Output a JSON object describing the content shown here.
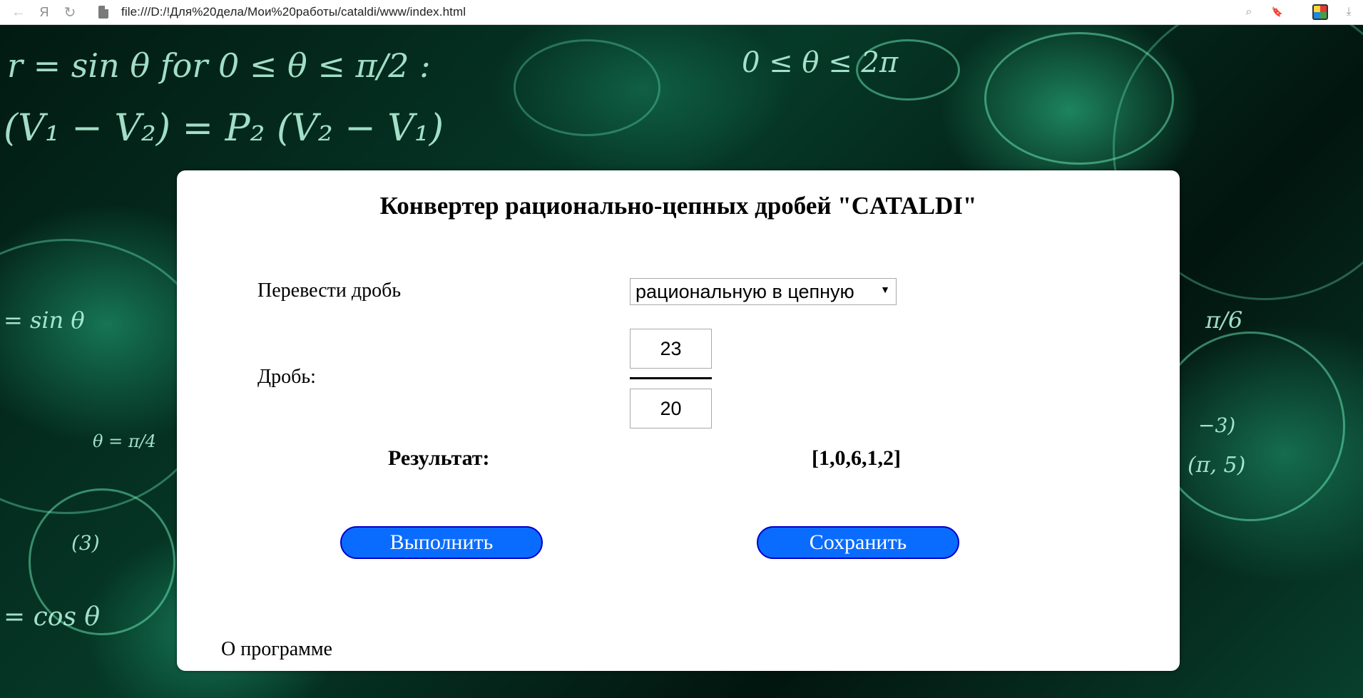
{
  "browser": {
    "back_glyph": "←",
    "yandex_glyph": "Я",
    "reload_glyph": "↻",
    "url": "file:///D:/!Для%20дела/Мои%20работы/cataldi/www/index.html",
    "zoom_glyph": "⌕",
    "bookmark_glyph": "🔖",
    "download_glyph": "⤓"
  },
  "background": {
    "formulas": [
      "r = sin θ  for 0 ≤ θ ≤ π/2 :",
      "(V₁ − V₂) = P₂ (V₂ − V₁)",
      "0 ≤ θ ≤ 2π",
      "= sin θ",
      "π/6",
      "= cos θ",
      "θ = π/4",
      "(π, 5)",
      "(3)",
      "−3)"
    ]
  },
  "app": {
    "title": "Конвертер рационально-цепных дробей \"CATALDI\"",
    "convert_label": "Перевести дробь",
    "mode_select_value": "рациональную в цепную",
    "mode_select_arrow": "▼",
    "fraction_label": "Дробь:",
    "numerator": "23",
    "denominator": "20",
    "result_label": "Результат:",
    "result_value": "[1,0,6,1,2]",
    "execute_button": "Выполнить",
    "save_button": "Сохранить",
    "about_link": "О программе"
  }
}
